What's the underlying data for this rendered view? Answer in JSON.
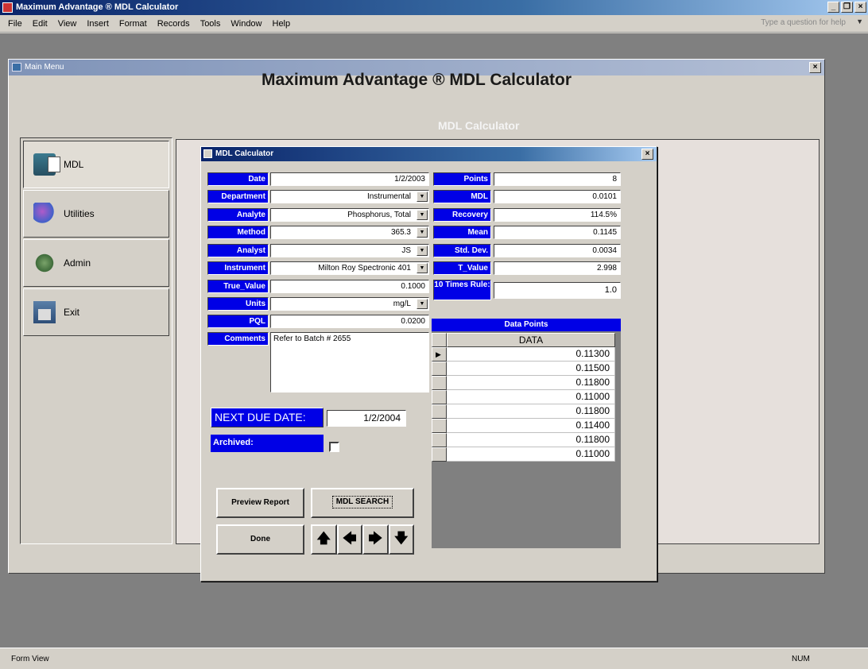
{
  "app": {
    "title": "Maximum Advantage ® MDL Calculator",
    "controls": {
      "minimize": "_",
      "restore": "❐",
      "close": "×"
    }
  },
  "menu": {
    "items": [
      "File",
      "Edit",
      "View",
      "Insert",
      "Format",
      "Records",
      "Tools",
      "Window",
      "Help"
    ],
    "help_placeholder": "Type a question for help"
  },
  "main_menu": {
    "window_title": "Main Menu",
    "title": "Maximum Advantage ® MDL Calculator",
    "subtitle": "MDL Calculator",
    "nav": [
      {
        "label": "MDL",
        "icon": "mdl-icon"
      },
      {
        "label": "Utilities",
        "icon": "utilities-icon"
      },
      {
        "label": "Admin",
        "icon": "admin-icon"
      },
      {
        "label": "Exit",
        "icon": "exit-icon"
      }
    ]
  },
  "dialog": {
    "title": "MDL Calculator",
    "left_fields": [
      {
        "label": "Date",
        "value": "1/2/2003",
        "combo": false
      },
      {
        "label": "Department",
        "value": "Instrumental",
        "combo": true
      },
      {
        "label": "Analyte",
        "value": "Phosphorus, Total",
        "combo": true
      },
      {
        "label": "Method",
        "value": "365.3",
        "combo": true
      },
      {
        "label": "Analyst",
        "value": "JS",
        "combo": true
      },
      {
        "label": "Instrument",
        "value": "Milton Roy Spectronic 401",
        "combo": true
      },
      {
        "label": "True_Value",
        "value": "0.1000",
        "combo": false
      },
      {
        "label": "Units",
        "value": "mg/L",
        "combo": true
      },
      {
        "label": "PQL",
        "value": "0.0200",
        "combo": false
      }
    ],
    "comments_label": "Comments",
    "comments_value": "Refer to Batch # 2655",
    "right_fields": [
      {
        "label": "Points",
        "value": "8"
      },
      {
        "label": "MDL",
        "value": "0.0101"
      },
      {
        "label": "Recovery",
        "value": "114.5%"
      },
      {
        "label": "Mean",
        "value": "0.1145"
      },
      {
        "label": "Std. Dev.",
        "value": "0.0034"
      },
      {
        "label": "T_Value",
        "value": "2.998"
      }
    ],
    "ten_times_label": "10 Times Rule:",
    "ten_times_value": "1.0",
    "next_due_label": "NEXT DUE DATE:",
    "next_due_value": "1/2/2004",
    "archived_label": "Archived:",
    "buttons": {
      "preview": "Preview Report",
      "search": "MDL SEARCH",
      "done": "Done"
    },
    "arrows": [
      "🡅",
      "🡄",
      "🡆",
      "🡇"
    ],
    "data_points": {
      "header": "Data Points",
      "column": "DATA",
      "current_marker": "▶",
      "values": [
        "0.11300",
        "0.11500",
        "0.11800",
        "0.11000",
        "0.11800",
        "0.11400",
        "0.11800",
        "0.11000"
      ]
    }
  },
  "status": {
    "left": "Form View",
    "right": "NUM"
  },
  "colors": {
    "label_blue": "#0000e6",
    "title_blue": "#0a246a"
  }
}
